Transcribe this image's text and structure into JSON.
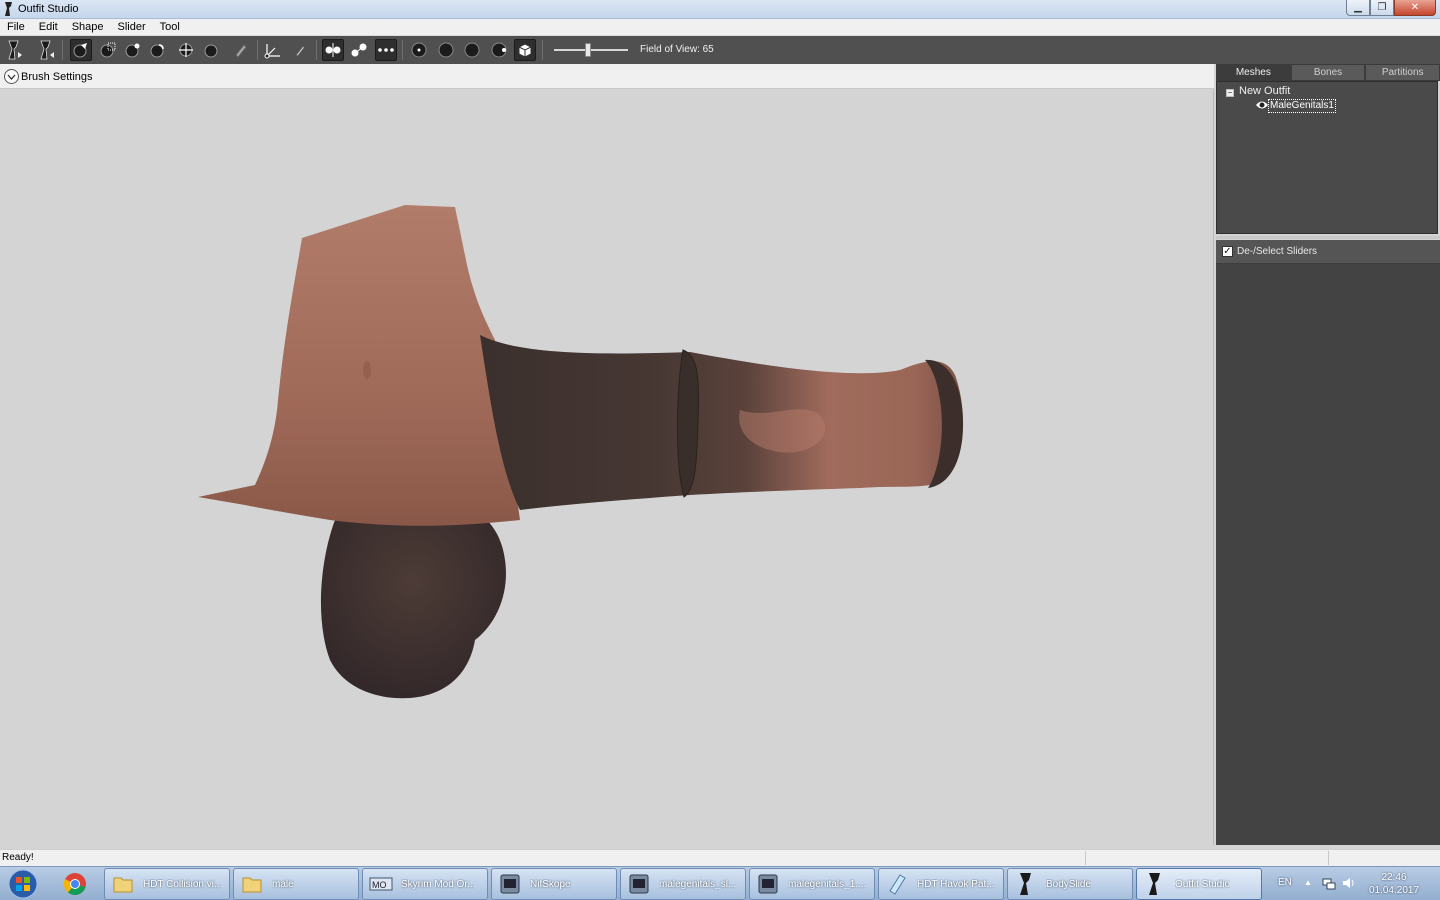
{
  "window": {
    "title": "Outfit Studio",
    "app_icon": "outfit-studio-icon",
    "controls": {
      "minimize_icon": "minimize-icon",
      "maximize_icon": "restore-icon",
      "close_icon": "close-icon"
    }
  },
  "menu": [
    "File",
    "Edit",
    "Shape",
    "Slider",
    "Tool"
  ],
  "toolbar": {
    "fov_label": "Field of View: 65",
    "fov_value": 65,
    "tools": [
      "export-shape-icon",
      "import-shape-icon",
      "select-brush-icon",
      "mask-brush-icon",
      "inflate-brush-icon",
      "deflate-brush-icon",
      "move-brush-icon",
      "smooth-brush-icon",
      "weight-brush-icon",
      "transform-icon",
      "pivot-icon",
      "symmetry-icon",
      "edge-icon",
      "vertices-icon",
      "brush-size-small-icon",
      "brush-size-medium-icon",
      "brush-size-large-icon",
      "brush-size-xlarge-icon",
      "texture-cube-icon"
    ]
  },
  "brush_settings": {
    "label": "Brush Settings",
    "icon": "chevron-down-icon"
  },
  "right_panel": {
    "tabs": [
      "Meshes",
      "Bones",
      "Partitions"
    ],
    "active_tab": "Meshes",
    "tree": {
      "root": "New Outfit",
      "child": "MaleGenitals1",
      "toggle": "−"
    },
    "sliders_header": "De-/Select Sliders",
    "sliders_checked": "✓"
  },
  "status": {
    "text": "Ready!"
  },
  "taskbar": {
    "start_icon": "windows-start-icon",
    "pinned": [
      "chrome-icon"
    ],
    "items": [
      {
        "label": "HDT Collision vi...",
        "icon": "folder-icon"
      },
      {
        "label": "male",
        "icon": "folder-icon"
      },
      {
        "label": "Skyrim Mod Or...",
        "icon": "mod-organizer-icon"
      },
      {
        "label": "NifSkope",
        "icon": "nifskope-icon"
      },
      {
        "label": "malegenitals_sl...",
        "icon": "nifskope-icon"
      },
      {
        "label": "malegenitals_1....",
        "icon": "nifskope-icon"
      },
      {
        "label": "HDT Havok Pat...",
        "icon": "notepad-icon"
      },
      {
        "label": "BodySlide",
        "icon": "bodyslide-icon"
      },
      {
        "label": "Outfit Studio",
        "icon": "outfit-studio-icon"
      }
    ],
    "tray": {
      "lang": "EN",
      "time": "22:46",
      "date": "01.04.2017"
    }
  },
  "colors": {
    "toolbar_bg": "#505050",
    "panel_bg": "#434343",
    "viewport_bg": "#d4d4d4",
    "model_skin": "#b07a68",
    "model_dark": "#4a3a35"
  }
}
